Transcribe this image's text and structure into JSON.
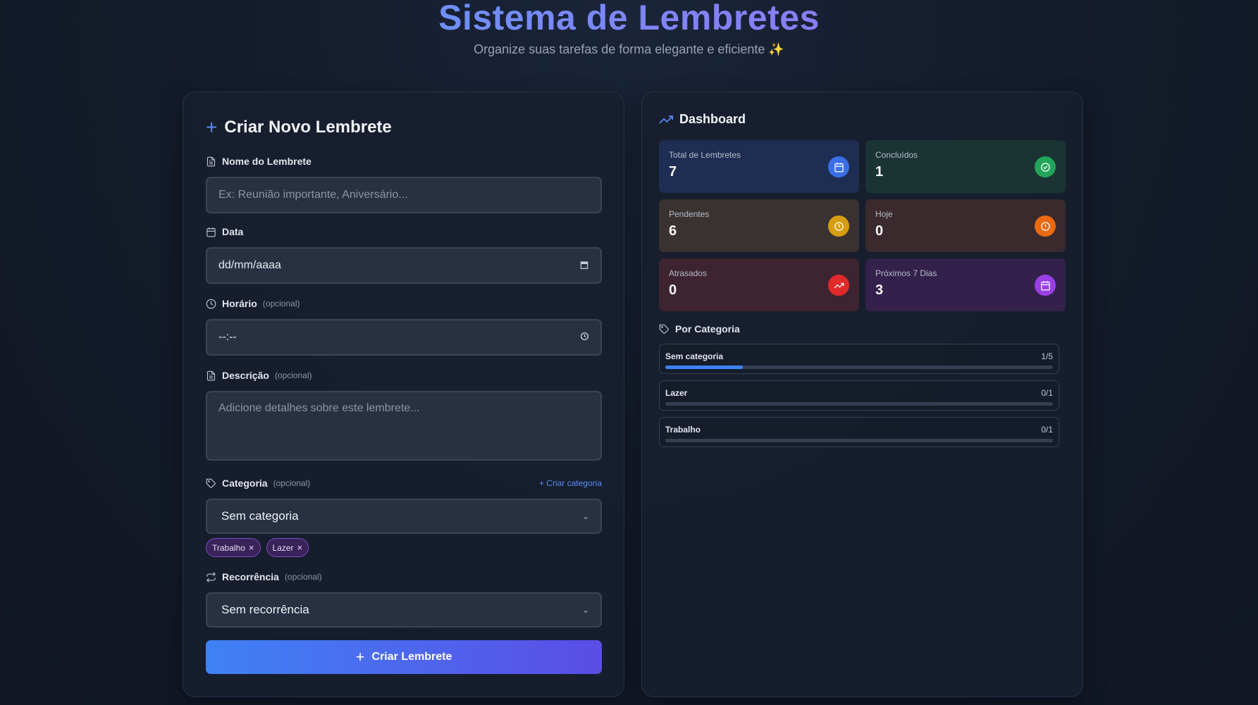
{
  "header": {
    "title": "Sistema de Lembretes",
    "subtitle": "Organize suas tarefas de forma elegante e eficiente",
    "subtitle_emoji": "✨"
  },
  "form": {
    "title": "Criar Novo Lembrete",
    "name_label": "Nome do Lembrete",
    "name_placeholder": "Ex: Reunião importante, Aniversário...",
    "date_label": "Data",
    "date_value": "dd/mm/aaaa",
    "time_label": "Horário",
    "time_optional": "(opcional)",
    "time_value": "--:--",
    "desc_label": "Descrição",
    "desc_optional": "(opcional)",
    "desc_placeholder": "Adicione detalhes sobre este lembrete...",
    "category_label": "Categoria",
    "category_optional": "(opcional)",
    "create_category_link": "+ Criar categoria",
    "category_selected": "Sem categoria",
    "category_chips": [
      {
        "label": "Trabalho",
        "remove": "×"
      },
      {
        "label": "Lazer",
        "remove": "×"
      }
    ],
    "recurrence_label": "Recorrência",
    "recurrence_optional": "(opcional)",
    "recurrence_selected": "Sem recorrência",
    "submit_label": "Criar Lembrete"
  },
  "dashboard": {
    "title": "Dashboard",
    "stats": [
      {
        "label": "Total de Lembretes",
        "value": "7",
        "icon": "calendar-icon",
        "bg": "#1e2d52",
        "icon_color": "#3b6fe8"
      },
      {
        "label": "Concluídos",
        "value": "1",
        "icon": "check-circle-icon",
        "bg": "#1a3433",
        "icon_color": "#22a55a"
      },
      {
        "label": "Pendentes",
        "value": "6",
        "icon": "clock-icon",
        "bg": "#3a3230",
        "icon_color": "#d69e0e"
      },
      {
        "label": "Hoje",
        "value": "0",
        "icon": "alert-circle-icon",
        "bg": "#3a2a2d",
        "icon_color": "#ea6a12"
      },
      {
        "label": "Atrasados",
        "value": "0",
        "icon": "trending-up-icon",
        "bg": "#3d2430",
        "icon_color": "#e02a2a"
      },
      {
        "label": "Próximos 7 Dias",
        "value": "3",
        "icon": "calendar-icon",
        "bg": "#33214b",
        "icon_color": "#9a3fe3"
      }
    ],
    "categories_title": "Por Categoria",
    "categories": [
      {
        "name": "Sem categoria",
        "count": "1/5",
        "progress": 0.2
      },
      {
        "name": "Lazer",
        "count": "0/1",
        "progress": 0
      },
      {
        "name": "Trabalho",
        "count": "0/1",
        "progress": 0
      }
    ]
  }
}
